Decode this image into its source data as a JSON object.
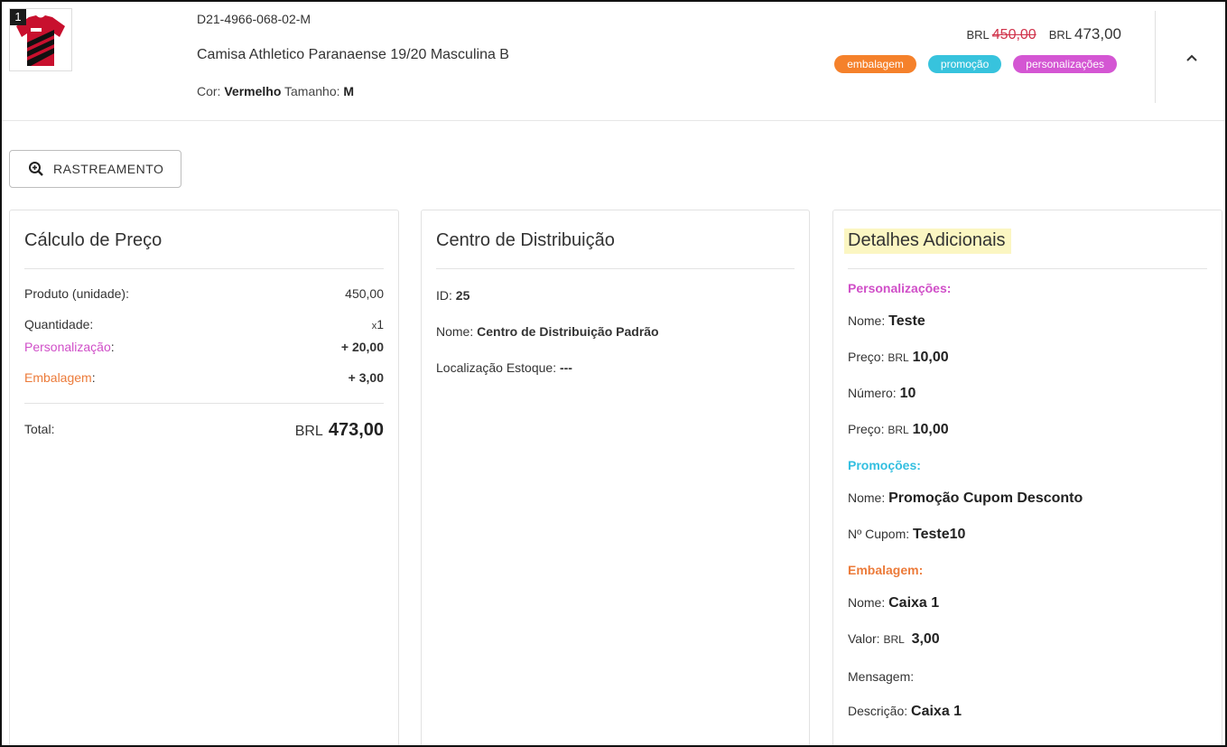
{
  "item": {
    "index": "1",
    "sku": "D21-4966-068-02-M",
    "name": "Camisa Athletico Paranaense 19/20 Masculina B",
    "color_label": "Cor:",
    "color_value": "Vermelho",
    "size_label": "Tamanho:",
    "size_value": "M",
    "old_currency": "BRL",
    "old_price": "450,00",
    "currency": "BRL",
    "price": "473,00",
    "tags": [
      {
        "label": "embalagem",
        "color": "#f5812b"
      },
      {
        "label": "promoção",
        "color": "#37c3dd"
      },
      {
        "label": "personalizações",
        "color": "#d456d3"
      }
    ]
  },
  "tracking_button": {
    "label": "RASTREAMENTO",
    "icon": "zoom-in-icon"
  },
  "price_calc": {
    "title": "Cálculo de Preço",
    "product_label": "Produto (unidade):",
    "product_value": "450,00",
    "qty_label": "Quantidade:",
    "qty_prefix": "x",
    "qty_value": "1",
    "custom_label": "Personalização",
    "custom_colon": ":",
    "custom_value": "+ 20,00",
    "pack_label": "Embalagem",
    "pack_colon": ":",
    "pack_value": "+ 3,00",
    "total_label": "Total:",
    "total_currency": "BRL",
    "total_value": "473,00"
  },
  "distribution": {
    "title": "Centro de Distribuição",
    "id_label": "ID:",
    "id_value": "25",
    "name_label": "Nome:",
    "name_value": "Centro de Distribuição Padrão",
    "loc_label": "Localização Estoque:",
    "loc_value": "---"
  },
  "details": {
    "title": "Detalhes Adicionais",
    "custom_header": "Personalizações:",
    "custom_name_label": "Nome:",
    "custom_name_value": "Teste",
    "custom_price_label": "Preço:",
    "custom_price_currency": "BRL",
    "custom_price_value": "10,00",
    "custom_number_label": "Número:",
    "custom_number_value": "10",
    "custom_price2_label": "Preço:",
    "custom_price2_currency": "BRL",
    "custom_price2_value": "10,00",
    "promo_header": "Promoções:",
    "promo_name_label": "Nome:",
    "promo_name_value": "Promoção Cupom Desconto",
    "promo_coupon_label": "Nº Cupom:",
    "promo_coupon_value": "Teste10",
    "pack_header": "Embalagem:",
    "pack_name_label": "Nome:",
    "pack_name_value": "Caixa 1",
    "pack_value_label": "Valor:",
    "pack_value_currency": "BRL",
    "pack_value_value": "3,00",
    "pack_msg_label": "Mensagem:",
    "pack_desc_label": "Descrição:",
    "pack_desc_value": "Caixa 1"
  }
}
